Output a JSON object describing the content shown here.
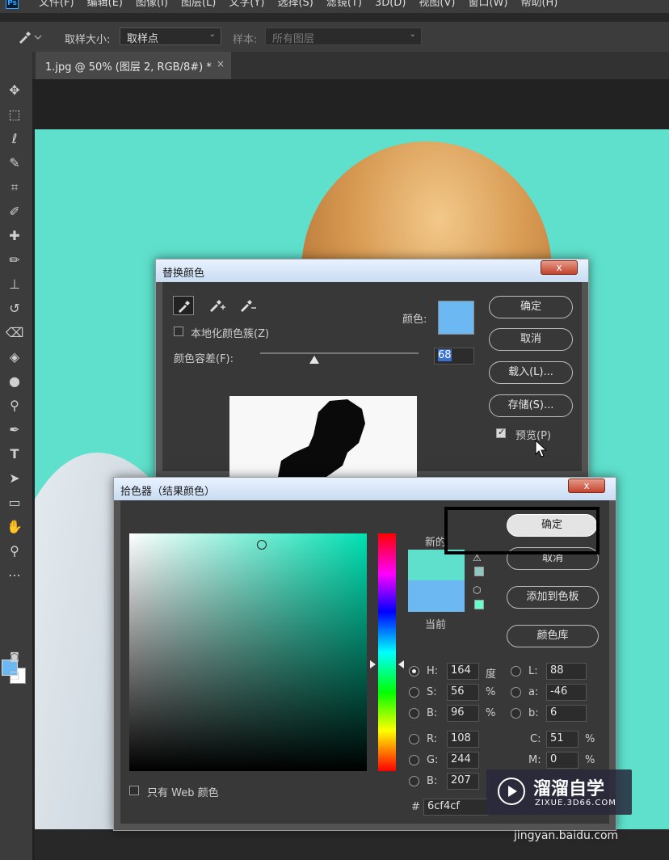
{
  "menubar": {
    "logo": "Ps",
    "items": [
      "文件(F)",
      "编辑(E)",
      "图像(I)",
      "图层(L)",
      "文字(Y)",
      "选择(S)",
      "滤镜(T)",
      "3D(D)",
      "视图(V)",
      "窗口(W)",
      "帮助(H)"
    ]
  },
  "options": {
    "sample_size_label": "取样大小:",
    "sample_size_value": "取样点",
    "sample_label": "样本:",
    "sample_value": "所有图层"
  },
  "document": {
    "tab_title": "1.jpg @ 50% (图层 2, RGB/8#) *",
    "close": "×"
  },
  "toolbar": {
    "foreground_color": "#6cb8f2",
    "background_color": "#ffffff"
  },
  "replace_color": {
    "title": "替换颜色",
    "close": "x",
    "color_label": "颜色:",
    "color_swatch": "#6cb8f2",
    "localized_label": "本地化颜色簇(Z)",
    "localized_checked": false,
    "fuzziness_label": "颜色容差(F):",
    "fuzziness_value": "68",
    "ok": "确定",
    "cancel": "取消",
    "load": "载入(L)...",
    "save": "存储(S)...",
    "preview_label": "预览(P)",
    "preview_checked": true
  },
  "color_picker": {
    "title": "拾色器（结果颜色）",
    "close": "x",
    "new_label": "新的",
    "current_label": "当前",
    "new_color": "#5fe0cc",
    "current_color": "#6cb8f2",
    "ok": "确定",
    "cancel": "取消",
    "add_to_swatches": "添加到色板",
    "color_libraries": "颜色库",
    "only_web_label": "只有 Web 颜色",
    "only_web_checked": false,
    "fields": {
      "H": {
        "label": "H:",
        "value": "164",
        "unit": "度"
      },
      "S": {
        "label": "S:",
        "value": "56",
        "unit": "%"
      },
      "Bv": {
        "label": "B:",
        "value": "96",
        "unit": "%"
      },
      "R": {
        "label": "R:",
        "value": "108"
      },
      "G": {
        "label": "G:",
        "value": "244"
      },
      "Bb": {
        "label": "B:",
        "value": "207"
      },
      "L": {
        "label": "L:",
        "value": "88"
      },
      "a": {
        "label": "a:",
        "value": "-46"
      },
      "b": {
        "label": "b:",
        "value": "6"
      },
      "C": {
        "label": "C:",
        "value": "51",
        "unit": "%"
      },
      "M": {
        "label": "M:",
        "value": "0",
        "unit": "%"
      }
    },
    "hex_label": "#",
    "hex_value": "6cf4cf"
  },
  "watermark": {
    "brand": "溜溜自学",
    "site": "ZIXUE.3D66.COM",
    "bottom_text": "jingyan.baidu.com"
  }
}
